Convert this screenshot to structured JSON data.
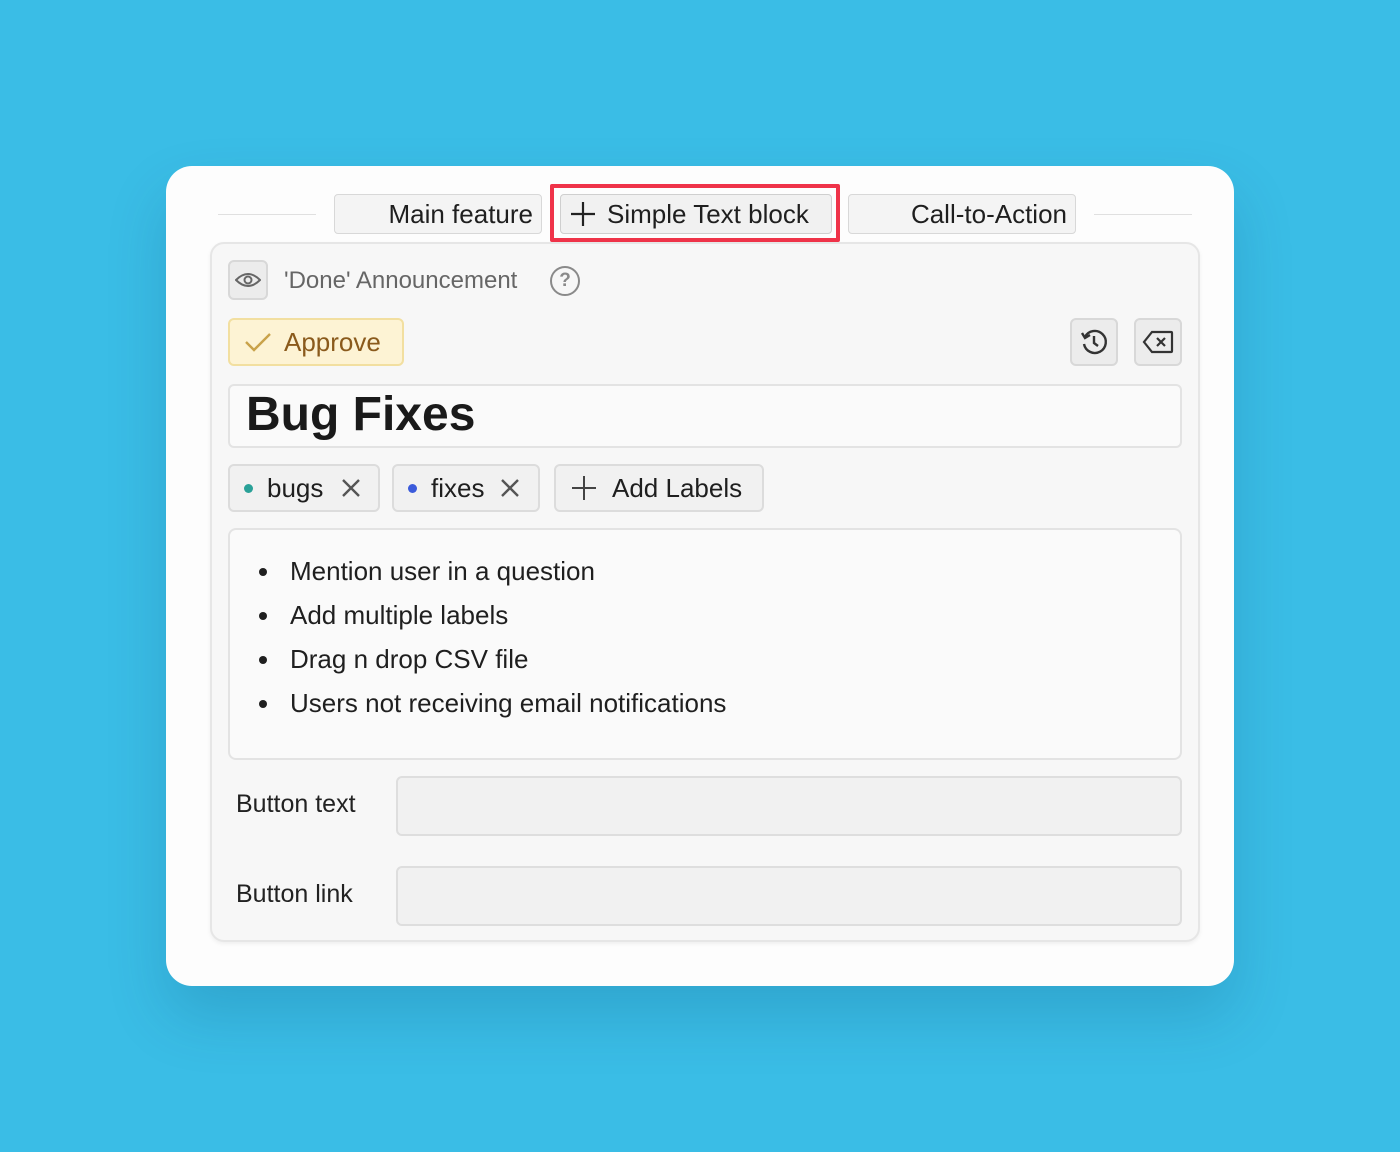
{
  "tabs": {
    "main_feature": "Main feature",
    "simple_text_block": "Simple Text block",
    "call_to_action": "Call-to-Action"
  },
  "block": {
    "title": "'Done' Announcement",
    "approve_label": "Approve",
    "heading": "Bug Fixes",
    "labels": [
      {
        "name": "bugs",
        "color": "#2aa198"
      },
      {
        "name": "fixes",
        "color": "#3b5bdb"
      }
    ],
    "add_labels": "Add Labels",
    "bullets": [
      "Mention user in a question",
      "Add multiple labels",
      "Drag n drop CSV file",
      "Users not receiving email notifications"
    ],
    "button_text_label": "Button text",
    "button_text_value": "",
    "button_link_label": "Button link",
    "button_link_value": ""
  },
  "colors": {
    "background": "#3abde6",
    "highlight": "#ef3349",
    "approve_bg": "#fdf3d4",
    "approve_text": "#8a5a1c"
  }
}
